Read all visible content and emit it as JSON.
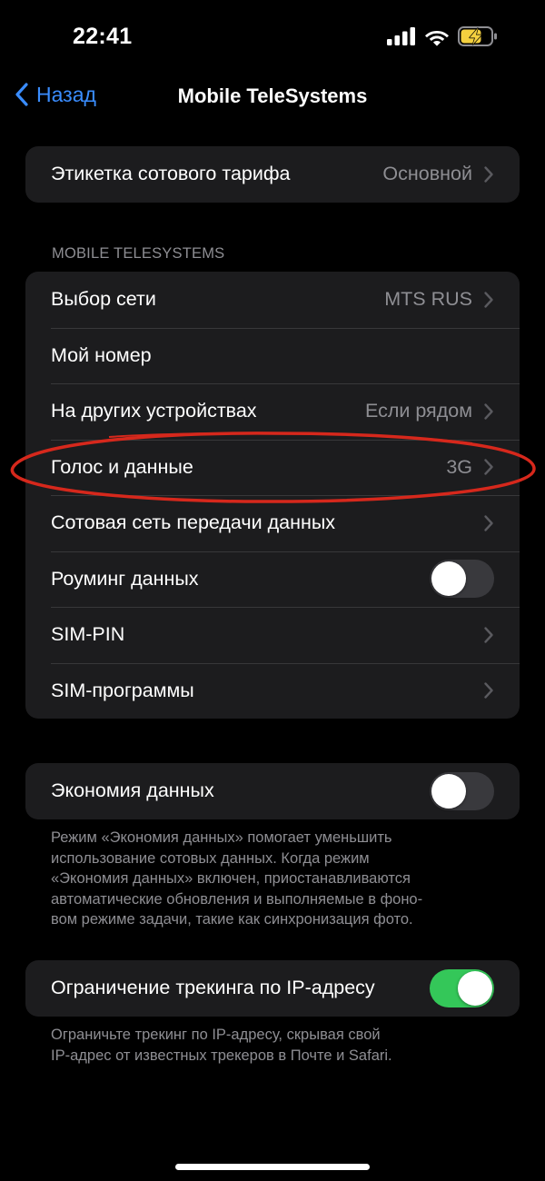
{
  "status": {
    "time": "22:41",
    "icons": [
      "cellular-signal-icon",
      "wifi-icon",
      "battery-charging-icon"
    ]
  },
  "nav": {
    "back_label": "Назад",
    "title": "Mobile TeleSystems"
  },
  "plan_group": {
    "label": "Этикетка сотового тарифа",
    "value": "Основной"
  },
  "carrier_section": {
    "header": "MOBILE TELESYSTEMS",
    "rows": [
      {
        "label": "Выбор сети",
        "value": "MTS RUS"
      },
      {
        "label": "Мой номер",
        "value": ""
      },
      {
        "label": "На других устройствах",
        "value": "Если рядом"
      },
      {
        "label": "Голос и данные",
        "value": "3G"
      },
      {
        "label": "Сотовая сеть передачи данных",
        "value": ""
      },
      {
        "label": "Роуминг данных",
        "toggle": false
      },
      {
        "label": "SIM-PIN",
        "value": ""
      },
      {
        "label": "SIM-программы",
        "value": ""
      }
    ]
  },
  "low_data": {
    "label": "Экономия данных",
    "toggle": false,
    "footer": [
      "Режим «Экономия данных» помогает уменьшить",
      "использование сотовых данных. Когда режим",
      "«Экономия данных» включен, приостанавливаются",
      "автоматические обновления и выполняемые в фоно-",
      "вом режиме задачи, такие как синхронизация фото."
    ]
  },
  "ip_tracking": {
    "label": "Ограничение трекинга по IP-адресу",
    "toggle": true,
    "footer": [
      "Ограничьте трекинг по IP-адресу, скрывая свой",
      "IP-адрес от известных трекеров в Почте и Safari."
    ]
  },
  "colors": {
    "background": "#000000",
    "cell": "#1c1c1e",
    "accent": "#3a8dff",
    "toggle_on": "#34c759",
    "annotation": "#d6281c"
  }
}
